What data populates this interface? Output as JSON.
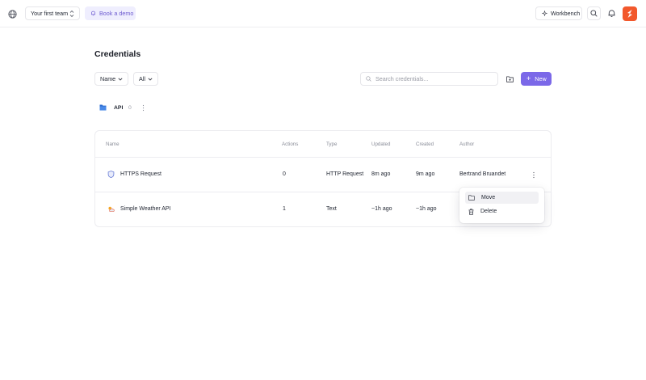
{
  "header": {
    "team_label": "Your first team",
    "demo_label": "Book a demo",
    "workbench_label": "Workbench"
  },
  "page": {
    "title": "Credentials"
  },
  "filters": {
    "sort_label": "Name",
    "scope_label": "All",
    "search_placeholder": "Search credentials...",
    "new_label": "New"
  },
  "folder": {
    "name": "API",
    "count": "0"
  },
  "table": {
    "columns": [
      "Name",
      "Actions",
      "Type",
      "Updated",
      "Created",
      "Author"
    ],
    "rows": [
      {
        "name": "HTTPS Request",
        "actions": "0",
        "type": "HTTP Request",
        "updated": "8m ago",
        "created": "9m ago",
        "author": "Bertrand Bruandet",
        "icon": "shield-icon"
      },
      {
        "name": "Simple Weather API",
        "actions": "1",
        "type": "Text",
        "updated": "~1h ago",
        "created": "~1h ago",
        "author": "",
        "icon": "weather-icon"
      }
    ]
  },
  "context_menu": {
    "items": [
      {
        "label": "Move",
        "icon": "folder-icon"
      },
      {
        "label": "Delete",
        "icon": "trash-icon"
      }
    ]
  },
  "colors": {
    "accent": "#7b68e8",
    "brand": "#f2582c",
    "folder": "#2f6fd1"
  }
}
